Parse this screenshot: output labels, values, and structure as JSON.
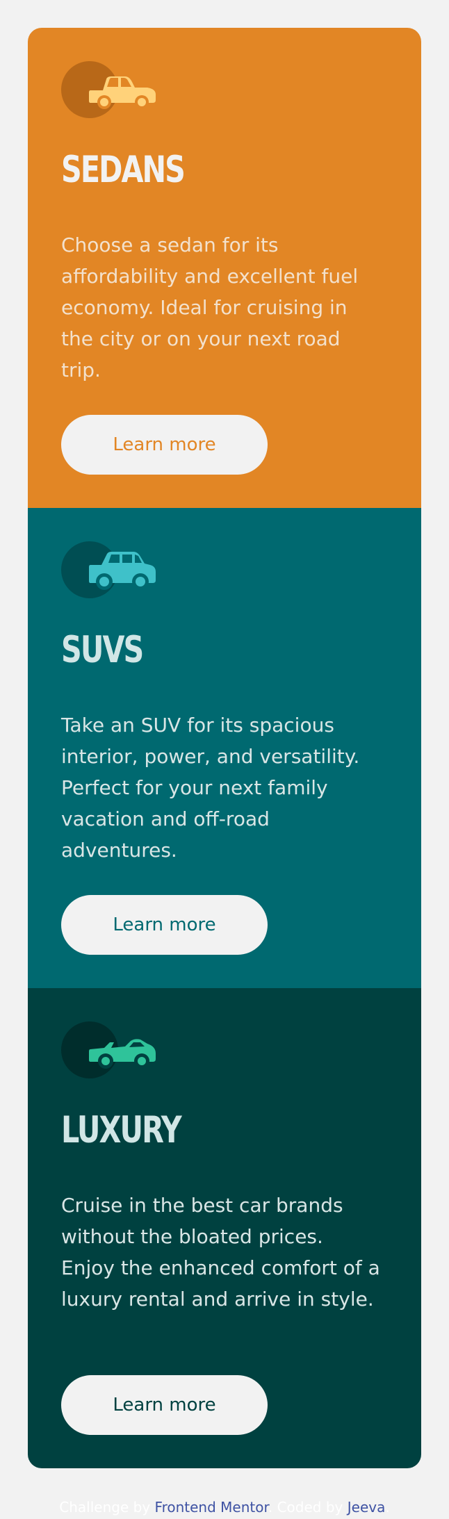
{
  "cards": [
    {
      "icon": "sedan-car-icon",
      "title": "SEDANS",
      "description": "Choose a sedan for its affordability and excellent fuel economy. Ideal for cruising in the city or on your next road trip.",
      "button_label": "Learn more",
      "background_color": "#e28625"
    },
    {
      "icon": "suv-car-icon",
      "title": "SUVS",
      "description": "Take an SUV for its spacious interior, power, and versatility. Perfect for your next family vacation and off-road adventures.",
      "button_label": "Learn more",
      "background_color": "#006970"
    },
    {
      "icon": "luxury-car-icon",
      "title": "LUXURY",
      "description": "Cruise in the best car brands without the bloated prices. Enjoy the enhanced comfort of a luxury rental and arrive in style.",
      "button_label": "Learn more",
      "background_color": "#004140"
    }
  ],
  "attribution": {
    "challenge_text": "Challenge by",
    "challenge_link": "Frontend Mentor",
    "coded_text": "Coded by",
    "coded_link": "Jeeva"
  },
  "colors": {
    "page_background": "#f2f2f2",
    "button_background": "#f2f2f2",
    "link_color": "#3e52a3"
  }
}
